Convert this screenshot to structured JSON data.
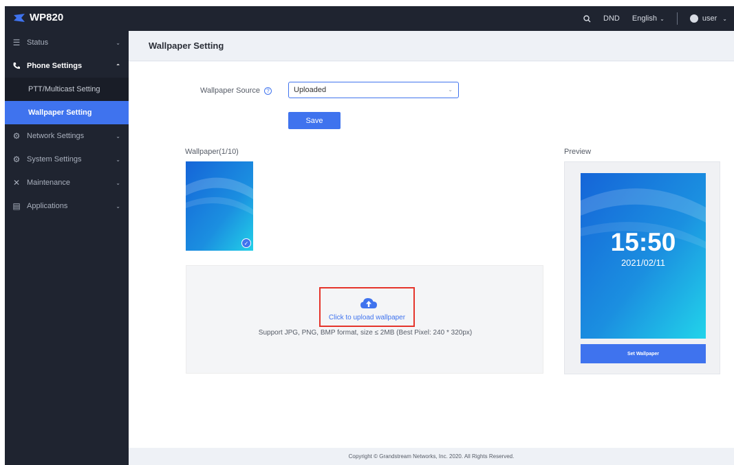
{
  "app": {
    "logo_text": "WP820"
  },
  "topbar": {
    "search_icon": "search-icon",
    "dnd": "DND",
    "language": "English",
    "user": "user"
  },
  "sidebar": {
    "items": [
      {
        "label": "Status",
        "icon": "list-icon"
      },
      {
        "label": "Phone Settings",
        "icon": "phone-icon",
        "open": true
      },
      {
        "label": "Network Settings",
        "icon": "network-icon"
      },
      {
        "label": "System Settings",
        "icon": "system-icon"
      },
      {
        "label": "Maintenance",
        "icon": "wrench-icon"
      },
      {
        "label": "Applications",
        "icon": "applications-icon"
      }
    ],
    "subitems": [
      {
        "label": "PTT/Multicast Setting"
      },
      {
        "label": "Wallpaper Setting",
        "active": true
      }
    ]
  },
  "page": {
    "title": "Wallpaper Setting"
  },
  "form": {
    "wallpaper_source_label": "Wallpaper Source",
    "wallpaper_source_value": "Uploaded",
    "save_label": "Save"
  },
  "wallpaper": {
    "title": "Wallpaper(1/10)",
    "upload_link": "Click to upload wallpaper",
    "upload_hint": "Support JPG, PNG, BMP format, size ≤ 2MB (Best Pixel: 240 * 320px)"
  },
  "preview": {
    "title": "Preview",
    "time": "15:50",
    "date": "2021/02/11",
    "set_label": "Set Wallpaper"
  },
  "footer": {
    "text": "Copyright © Grandstream Networks, Inc. 2020. All Rights Reserved."
  },
  "colors": {
    "accent": "#3f73ee",
    "sidebar_bg": "#1f2430",
    "highlight_border": "#e5332a"
  }
}
